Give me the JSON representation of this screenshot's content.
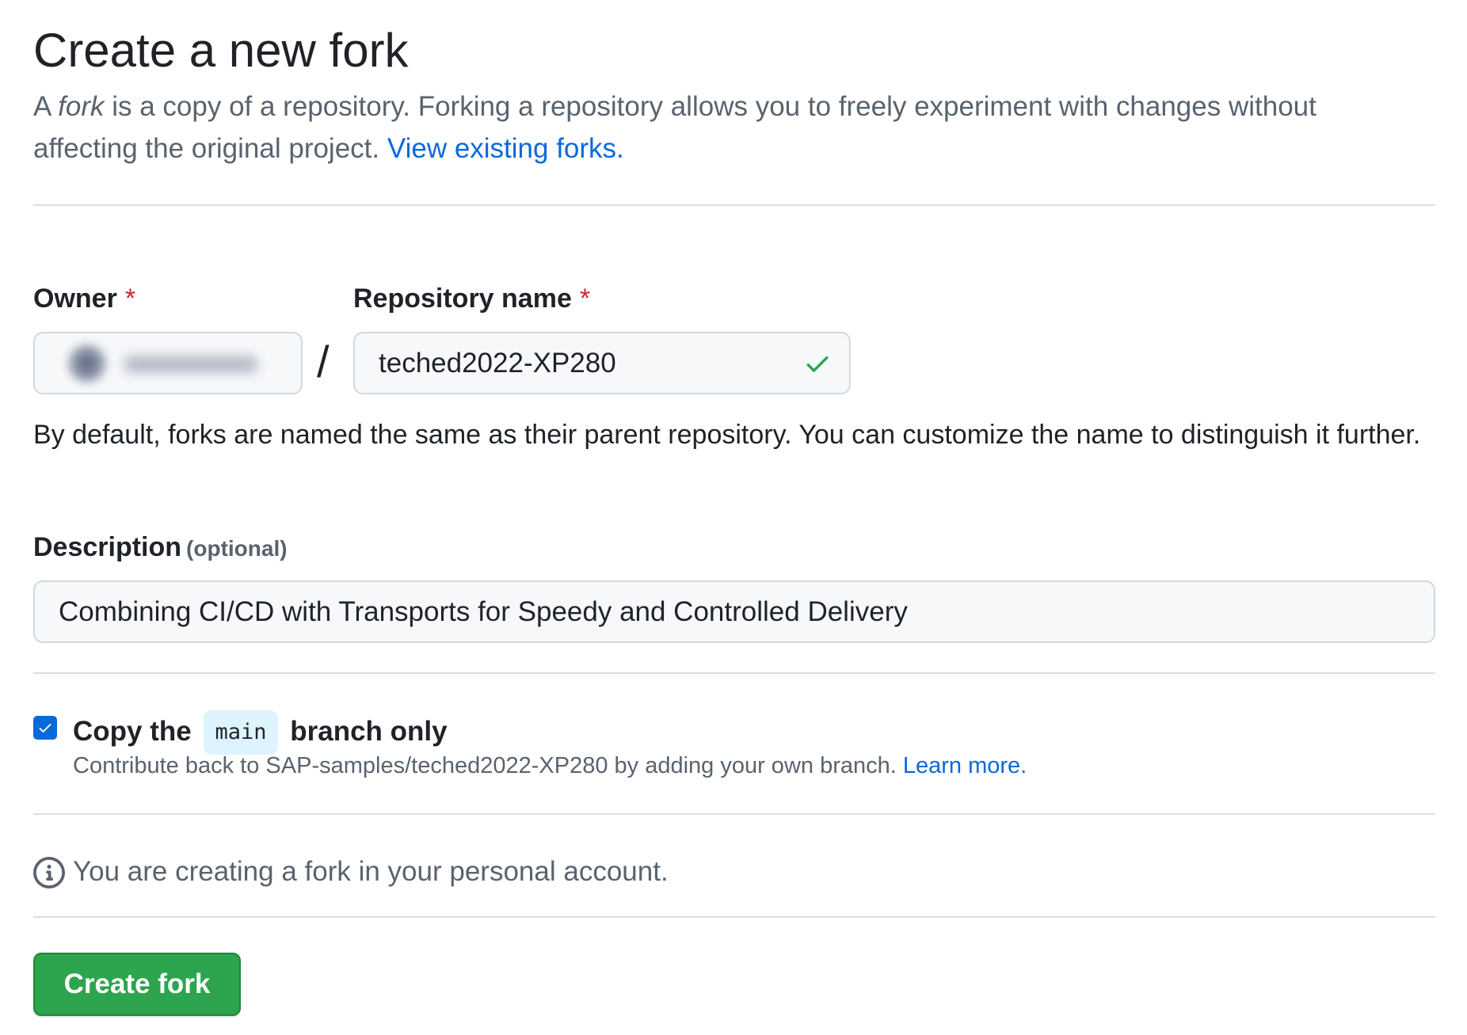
{
  "header": {
    "title": "Create a new fork",
    "intro_prefix": "A ",
    "intro_fork_word": "fork",
    "intro_rest": " is a copy of a repository. Forking a repository allows you to freely experiment with changes without affecting the original project. ",
    "view_forks_link": "View existing forks."
  },
  "form": {
    "owner_label": "Owner",
    "required_marker": "*",
    "separator": "/",
    "repo_label": "Repository name",
    "repo_value": "teched2022-XP280",
    "repo_status": "valid",
    "name_hint": "By default, forks are named the same as their parent repository. You can customize the name to distinguish it further.",
    "description_label": "Description",
    "description_optional": "(optional)",
    "description_value": "Combining CI/CD with Transports for Speedy and Controlled Delivery"
  },
  "branch_option": {
    "checked": true,
    "label_prefix": "Copy the",
    "branch_name": "main",
    "label_suffix": "branch only",
    "help_text": "Contribute back to SAP-samples/teched2022-XP280 by adding your own branch. ",
    "learn_more_link": "Learn more."
  },
  "notice": {
    "icon": "info-icon",
    "text": "You are creating a fork in your personal account."
  },
  "actions": {
    "create_label": "Create fork"
  },
  "colors": {
    "link": "#0969da",
    "primary_button": "#2da44e",
    "success_check": "#2da44e",
    "required": "#d1242f",
    "branch_chip": "#ddf4ff"
  }
}
